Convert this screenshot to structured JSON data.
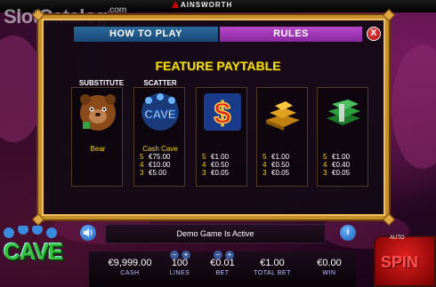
{
  "app": {
    "watermark": "SlotCatalog",
    "watermark_suffix": ".com",
    "brand": "AINSWORTH"
  },
  "tabs": {
    "how_to_play": "HOW TO PLAY",
    "rules": "RULES",
    "close": "X"
  },
  "paytable": {
    "title": "FEATURE PAYTABLE",
    "cards": [
      {
        "header": "SUBSTITUTE",
        "name": "Bear",
        "icon": "bear-icon",
        "rows": []
      },
      {
        "header": "SCATTER",
        "name": "Cash Cave",
        "icon": "cash-cave-icon",
        "rows": [
          {
            "count": "5",
            "amount": "€75.00"
          },
          {
            "count": "4",
            "amount": "€10.00"
          },
          {
            "count": "3",
            "amount": "€5.00"
          }
        ]
      },
      {
        "header": "",
        "name": "",
        "icon": "dollar-icon",
        "rows": [
          {
            "count": "5",
            "amount": "€1.00"
          },
          {
            "count": "4",
            "amount": "€0.50"
          },
          {
            "count": "3",
            "amount": "€0.05"
          }
        ]
      },
      {
        "header": "",
        "name": "",
        "icon": "gold-bars-icon",
        "rows": [
          {
            "count": "5",
            "amount": "€1.00"
          },
          {
            "count": "4",
            "amount": "€0.50"
          },
          {
            "count": "3",
            "amount": "€0.05"
          }
        ]
      },
      {
        "header": "",
        "name": "",
        "icon": "cash-stack-icon",
        "rows": [
          {
            "count": "5",
            "amount": "€1.00"
          },
          {
            "count": "4",
            "amount": "€0.40"
          },
          {
            "count": "3",
            "amount": "€0.05"
          }
        ]
      }
    ]
  },
  "game_logo": "CAVE",
  "message": "Demo Game Is Active",
  "info_label": "i",
  "stats": {
    "cash": {
      "value": "€9,999.00",
      "label": "CASH"
    },
    "lines": {
      "value": "100",
      "label": "LINES"
    },
    "bet": {
      "value": "€0.01",
      "label": "BET"
    },
    "total_bet": {
      "value": "€1.00",
      "label": "TOTAL BET"
    },
    "win": {
      "value": "€0.00",
      "label": "WIN"
    }
  },
  "controls": {
    "minus": "−",
    "plus": "+",
    "auto": "AUTO",
    "spin": "SPIN"
  },
  "colors": {
    "title": "#f2e010",
    "frame_gold": "#c8902a",
    "tab_how_to_play": "#2a6a9a",
    "tab_rules": "#b848c8",
    "logo_green": "#38c040",
    "spin_red": "#e02020"
  }
}
